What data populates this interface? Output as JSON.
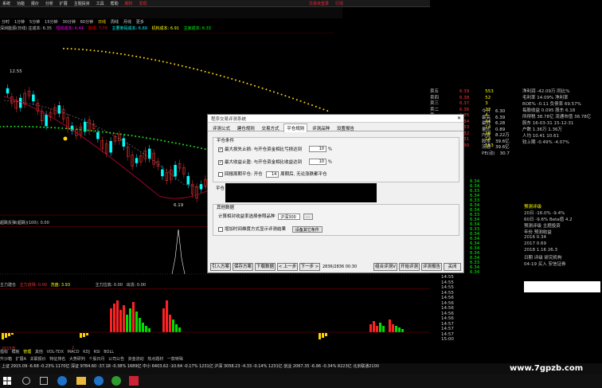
{
  "menu": {
    "items": [
      "系统",
      "功能",
      "报价",
      "分析",
      "扩展",
      "主题投资",
      "工具",
      "帮助"
    ],
    "highlight_items": [
      "期权",
      "发现"
    ],
    "right_items": [
      "交易未登录",
      "行情"
    ]
  },
  "timeframes": {
    "items": [
      "分时",
      "1分钟",
      "5分钟",
      "15分钟",
      "30分钟",
      "60分钟",
      "日线",
      "周线",
      "月线",
      "更多"
    ],
    "selected": "日线"
  },
  "legend": {
    "text1": "深圳能源(日线) 庄成本: 6.35",
    "text2": "短线成本: 6.44",
    "text3": "高线: 7.78",
    "text4": "主要筹码成本: 6.69",
    "text5": "机构成本: 6.91",
    "text6": "主家成本: 6.33"
  },
  "chart": {
    "price_label_high": "12.55",
    "price_label_low": "6.19",
    "indicator_label": "超跌反弹(超跌)(100): 0.00",
    "vol_label1": "主力建仓",
    "vol_label2": "主力进场: 0.00",
    "vol_label3": "洗盘: 3.93",
    "vol_label4": "主力拉高: 0.00",
    "vol_label5": "出货: 0.00",
    "axis_left": "2015年",
    "axis_mid": "2",
    "axis_right_a": "11",
    "axis_right_b": "12"
  },
  "right_panel": {
    "title_price": "6.30",
    "rows": [
      {
        "k": "卖五",
        "v": "6.39",
        "n": "553"
      },
      {
        "k": "卖四",
        "v": "6.38",
        "n": "52"
      },
      {
        "k": "卖三",
        "v": "6.37",
        "n": "3"
      },
      {
        "k": "卖二",
        "v": "6.36",
        "n": "22"
      },
      {
        "k": "卖一",
        "v": "6.35",
        "n": "4"
      },
      {
        "k": "买一",
        "v": "6.34",
        "n": "44"
      },
      {
        "k": "买二",
        "v": "6.33",
        "n": "14"
      },
      {
        "k": "买三",
        "v": "6.32",
        "n": "18"
      },
      {
        "k": "买四",
        "v": "6.31",
        "n": "14"
      },
      {
        "k": "买五",
        "v": "6.30",
        "n": "553"
      }
    ],
    "stats": [
      {
        "k": "今开",
        "v": "6.30"
      },
      {
        "k": "最高",
        "v": "6.39"
      },
      {
        "k": "最低",
        "v": "6.28"
      },
      {
        "k": "量比",
        "v": "0.89"
      },
      {
        "k": "内盘",
        "v": "8.22万"
      },
      {
        "k": "股本",
        "v": "39.6亿"
      },
      {
        "k": "流通",
        "v": "39.6亿"
      },
      {
        "k": "PE(动)",
        "v": "30.7"
      }
    ],
    "info": [
      "净利润 -42.09万 同比%",
      "毛利率 14.09% 净利率",
      "ROE% -0.11 负债率 69.57%",
      "每股收益 0.095 股东 6.18",
      "所得税 38.78亿 流通市值 38.78亿",
      "股东 16-03-31 15-12-31",
      "户数 1.36万 1.36万",
      "人均 10.41 10.61",
      "较上期 -0.49% -4.07%"
    ],
    "price_list": [
      "6.34",
      "6.34",
      "6.33",
      "6.34",
      "6.33",
      "6.34",
      "6.34",
      "6.33",
      "6.34",
      "6.34",
      "6.33",
      "6.34",
      "6.34",
      "6.34",
      "6.34",
      "6.34",
      "6.34",
      "6.33",
      "6.34",
      "6.34"
    ],
    "time_list": [
      "14:55",
      "14:55",
      "14:55",
      "14:55",
      "14:56",
      "14:56",
      "14:56",
      "14:56",
      "14:56",
      "14:57",
      "14:57",
      "14:57",
      "15:00"
    ],
    "broker_rows": [
      "20日 -16.0% -9.4%",
      "60日 -9.6% Beta值 4.2",
      "预测评级 主题投资",
      "年份 预测收益",
      "2016 0.34",
      "2017 0.69",
      "2018 1.16 26.3",
      "日期 评级 研究机构",
      "04-19 买入 安信证券"
    ],
    "side_title": "预测评级"
  },
  "dialog": {
    "title": "程序交易评测系统",
    "tabs": [
      "评测公式",
      "建仓规则",
      "交易方式",
      "平仓规则",
      "评测品种",
      "设置报告"
    ],
    "active_tab": "平仓规则",
    "group1_title": "平仓条件",
    "row1_label": "最大损失止损: 与开仓资金相比亏损达到",
    "row1_value": "10",
    "row1_unit": "%",
    "row2_label": "最大收益止盈: 与开仓资金相比收益达到",
    "row2_value": "10",
    "row2_unit": "%",
    "row3_label": "回报周期平仓: 开仓",
    "row3_value": "14",
    "row3_suffix": "周期后, 无论涨跌都平仓",
    "group2_label": "平仓",
    "group3_title": "其他数据",
    "row4_label": "计算相对收益率选择参照品种",
    "row4_value": "沪深300",
    "row5_label": "增加时间维度方式显示评测结果",
    "row5_button": "设备其它条件",
    "buttons": [
      "引入方案",
      "保存方案",
      "下载数据",
      "< 上一步",
      "下一步 >"
    ],
    "status_text": "2836/2836 00:30",
    "buttons_right": [
      "组合评测V",
      "开始评测",
      "评测报告",
      "关闭"
    ]
  },
  "bottom_tabs": {
    "row1": [
      "指标",
      "模板",
      "管理",
      "其他",
      "VOL-TDX",
      "MACD",
      "KDJ",
      "RSI",
      "BOLL"
    ],
    "row2": [
      "升沙箱",
      "扩展A",
      "关联报价",
      "特征排名",
      "大势研判",
      "个股日月",
      "公司公告",
      "资金流动",
      "热点题材",
      "一款特殊"
    ]
  },
  "statusbar": {
    "text": "上证 2915.09 -6.68 -0.23% 1170亿  深证 9784.60 -37.18 -0.38% 1689亿  中小 6403.62 -10.64 -0.17% 1231亿  沪深 3058.23 -4.33 -0.14% 1231亿  创业 2067.35 -6.96 -0.34% 8223亿  北京联通2100"
  },
  "watermark": "www.7gpzb.com"
}
